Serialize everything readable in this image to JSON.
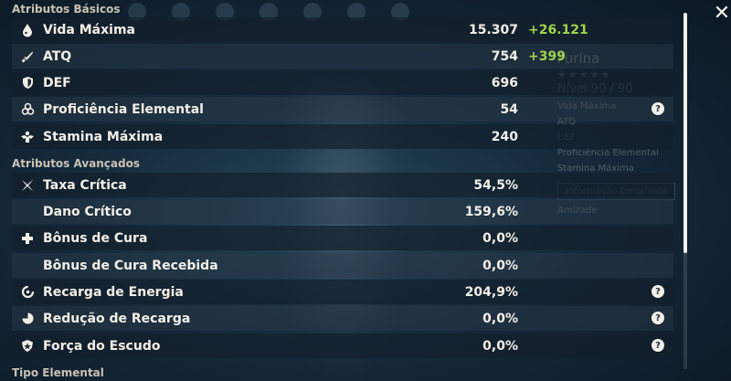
{
  "sections": {
    "basic": "Atributos Básicos",
    "advanced": "Atributos Avançados",
    "elemental": "Tipo Elemental"
  },
  "stats": [
    {
      "icon": "water-drop-icon",
      "label": "Vida Máxima",
      "value": "15.307",
      "bonus": "+26.121",
      "help": false
    },
    {
      "icon": "sword-icon",
      "label": "ATQ",
      "value": "754",
      "bonus": "+399",
      "help": false
    },
    {
      "icon": "shield-icon",
      "label": "DEF",
      "value": "696",
      "bonus": "",
      "help": false
    },
    {
      "icon": "elemental-mastery-icon",
      "label": "Proficiência Elemental",
      "value": "54",
      "bonus": "",
      "help": true
    },
    {
      "icon": "stamina-icon",
      "label": "Stamina Máxima",
      "value": "240",
      "bonus": "",
      "help": false
    },
    {
      "icon": "crit-rate-icon",
      "label": "Taxa Crítica",
      "value": "54,5%",
      "bonus": "",
      "help": false
    },
    {
      "icon": "",
      "label": "Dano Crítico",
      "value": "159,6%",
      "bonus": "",
      "help": false
    },
    {
      "icon": "healing-cross-icon",
      "label": "Bônus de Cura",
      "value": "0,0%",
      "bonus": "",
      "help": false
    },
    {
      "icon": "",
      "label": "Bônus de Cura Recebida",
      "value": "0,0%",
      "bonus": "",
      "help": false
    },
    {
      "icon": "energy-recharge-icon",
      "label": "Recarga de Energia",
      "value": "204,9%",
      "bonus": "",
      "help": true
    },
    {
      "icon": "cd-reduction-icon",
      "label": "Redução de Recarga",
      "value": "0,0%",
      "bonus": "",
      "help": true
    },
    {
      "icon": "shield-strength-icon",
      "label": "Força do Escudo",
      "value": "0,0%",
      "bonus": "",
      "help": true
    }
  ],
  "help_glyph": "?",
  "close_glyph": "✕",
  "background_panel": {
    "name": "Furina",
    "stars": "★★★★★",
    "level": "Nível 90 / 90",
    "lines": [
      "Vida Máxima",
      "ATQ",
      "DEF",
      "Proficiência Elemental",
      "Stamina Máxima"
    ],
    "details_button": "Informação Detalhada",
    "friendship": "Amizade"
  },
  "colors": {
    "bonus_green": "#9fd34a",
    "text": "#f3efe6"
  }
}
